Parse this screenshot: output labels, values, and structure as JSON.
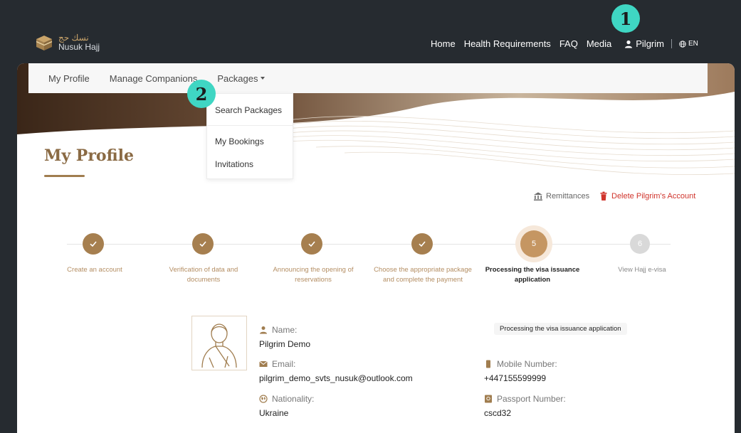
{
  "brand": {
    "name_ar": "نسك حج",
    "name_en": "Nusuk Hajj"
  },
  "topnav": {
    "home": "Home",
    "health": "Health Requirements",
    "faq": "FAQ",
    "media": "Media",
    "user": "Pilgrim",
    "lang": "EN"
  },
  "annotations": {
    "one": "1",
    "two": "2"
  },
  "subnav": {
    "profile": "My Profile",
    "companions": "Manage Companions",
    "packages": "Packages"
  },
  "dropdown": {
    "search": "Search Packages",
    "bookings": "My Bookings",
    "invitations": "Invitations"
  },
  "page": {
    "title": "My Profile",
    "remittances": "Remittances",
    "delete": "Delete Pilgrim's Account"
  },
  "steps": [
    {
      "label": "Create an account",
      "status": "done"
    },
    {
      "label": "Verification of data and documents",
      "status": "done"
    },
    {
      "label": "Announcing the opening of reservations",
      "status": "done"
    },
    {
      "label": "Choose the appropriate package and complete the payment",
      "status": "done"
    },
    {
      "label": "Processing the visa issuance application",
      "status": "active",
      "number": "5"
    },
    {
      "label": "View Hajj e-visa",
      "status": "todo",
      "number": "6"
    }
  ],
  "profile": {
    "status": "Processing the visa issuance application",
    "name_label": "Name:",
    "name": "Pilgrim Demo",
    "email_label": "Email:",
    "email": "pilgrim_demo_svts_nusuk@outlook.com",
    "nationality_label": "Nationality:",
    "nationality": "Ukraine",
    "mobile_label": "Mobile Number:",
    "mobile": "+447155599999",
    "passport_label": "Passport Number:",
    "passport": "cscd32"
  },
  "colors": {
    "accent": "#a67f4f",
    "badge": "#3fd6c3",
    "danger": "#d0342c",
    "dark": "#262b30"
  }
}
